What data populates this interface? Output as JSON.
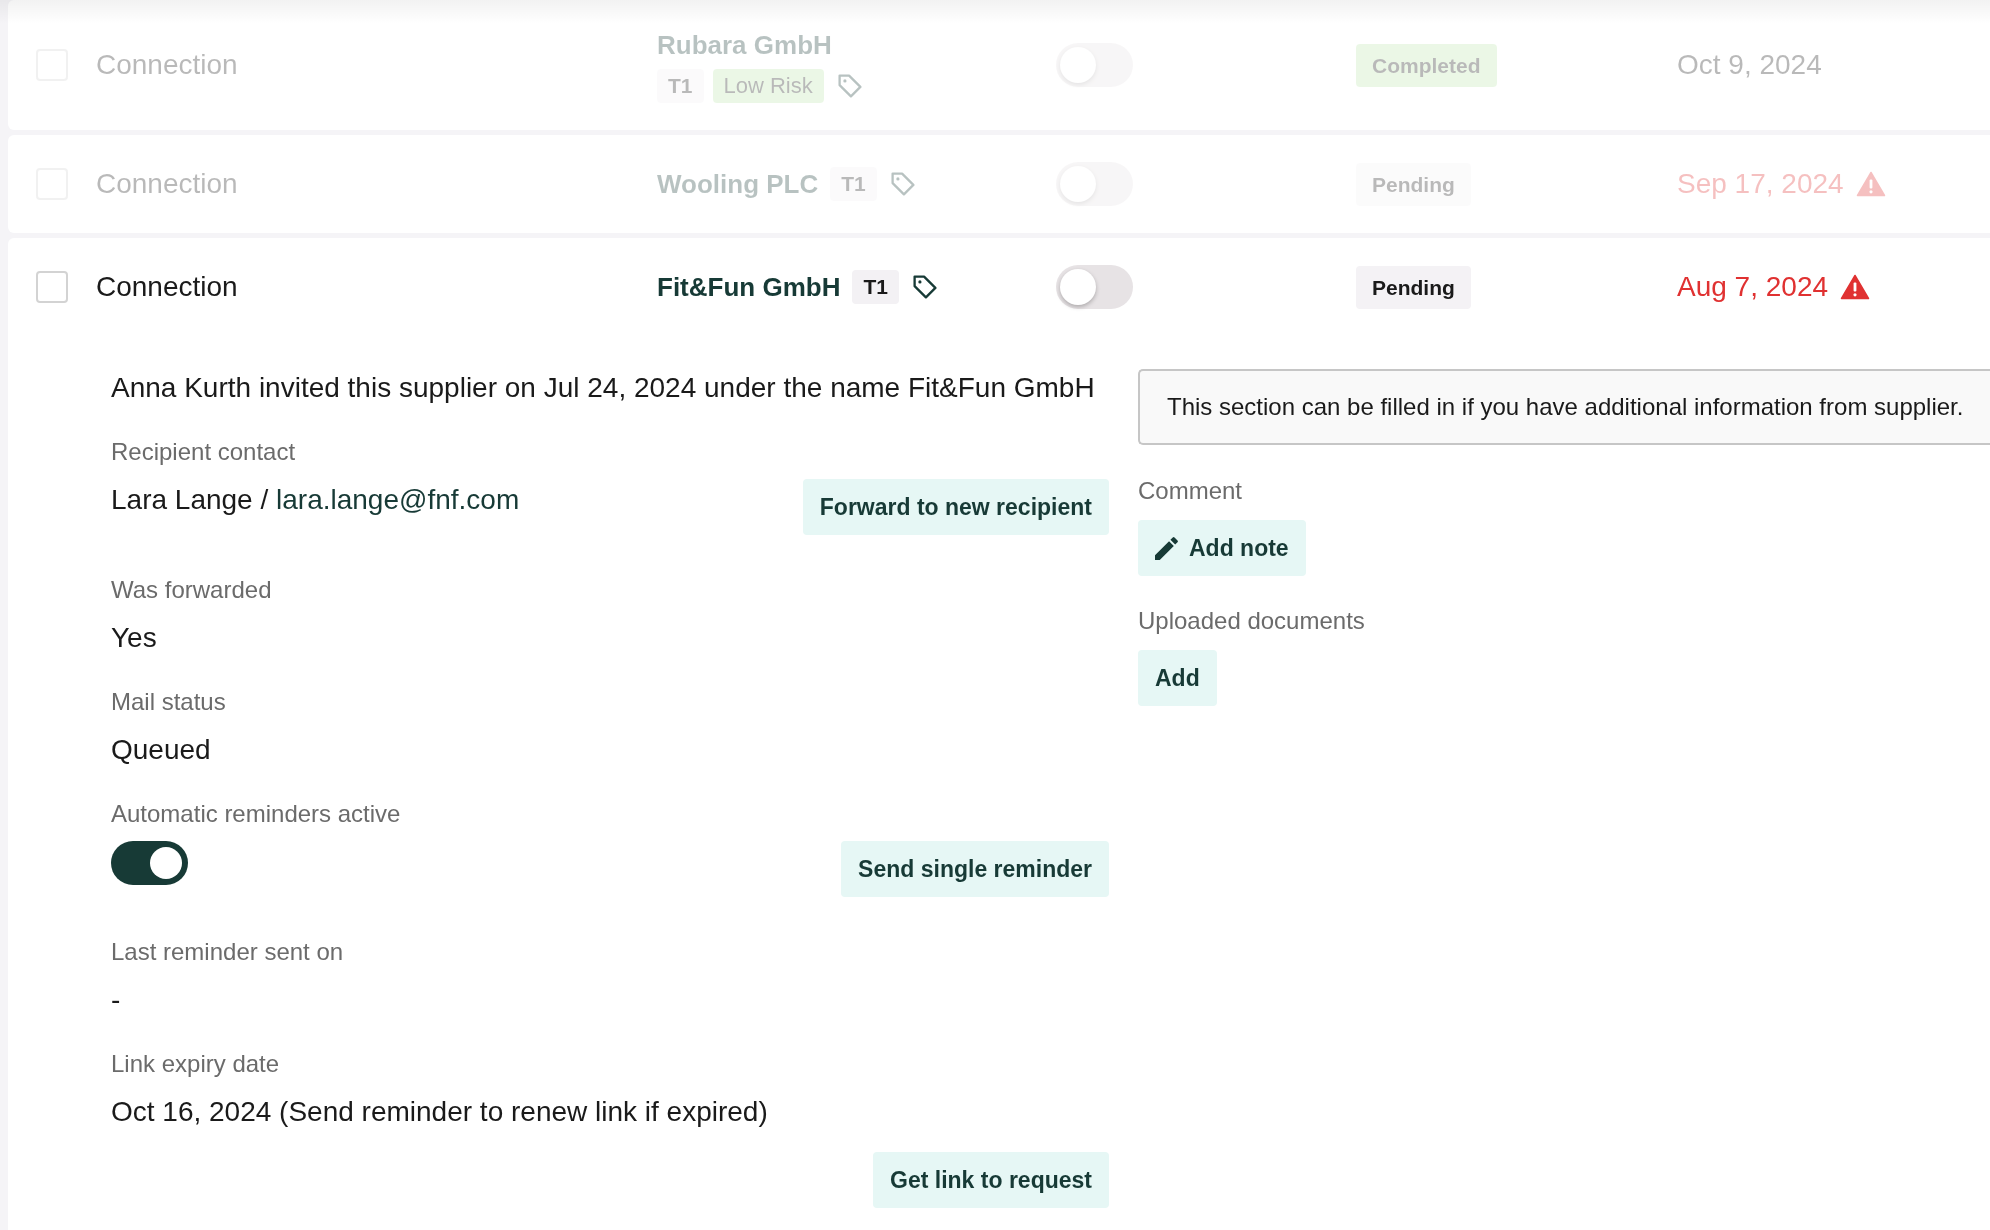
{
  "rows": [
    {
      "selected": false,
      "type_label": "Connection",
      "company": "Rubara GmbH",
      "tags": [
        {
          "label": "T1",
          "kind": "tier"
        },
        {
          "label": "Low Risk",
          "kind": "risk"
        }
      ],
      "switch_on": false,
      "status": {
        "label": "Completed",
        "kind": "completed"
      },
      "date": "Oct 9, 2024",
      "overdue": false,
      "expanded": false
    },
    {
      "selected": false,
      "type_label": "Connection",
      "company": "Wooling PLC",
      "tags": [
        {
          "label": "T1",
          "kind": "tier"
        }
      ],
      "switch_on": false,
      "status": {
        "label": "Pending",
        "kind": "pending"
      },
      "date": "Sep 17, 2024",
      "overdue": true,
      "expanded": false
    },
    {
      "selected": false,
      "type_label": "Connection",
      "company": "Fit&Fun GmbH",
      "tags": [
        {
          "label": "T1",
          "kind": "tier"
        }
      ],
      "switch_on": false,
      "status": {
        "label": "Pending",
        "kind": "pending"
      },
      "date": "Aug 7, 2024",
      "overdue": true,
      "expanded": true,
      "details": {
        "invite_note": "Anna Kurth invited this supplier on Jul 24, 2024 under the name Fit&Fun GmbH",
        "fields": [
          {
            "kind": "contact",
            "label": "Recipient contact",
            "prefix": "Lara Lange /",
            "email": "lara.lange@fnf.com",
            "button": "Forward to new recipient"
          },
          {
            "kind": "text",
            "label": "Was forwarded",
            "value": "Yes"
          },
          {
            "kind": "text",
            "label": "Mail status",
            "value": "Queued"
          },
          {
            "kind": "toggle",
            "label": "Automatic reminders active",
            "on": true,
            "button": "Send single reminder"
          },
          {
            "kind": "text",
            "label": "Last reminder sent on",
            "value": "-"
          },
          {
            "kind": "text",
            "label": "Link expiry date",
            "value": "Oct 16, 2024 (Send reminder to renew link if expired)"
          }
        ],
        "link_button": "Get link to request",
        "info_note": "This section can be filled in if you have additional information from supplier.",
        "comment": {
          "label": "Comment",
          "button": "Add note"
        },
        "documents": {
          "label": "Uploaded documents",
          "button": "Add"
        }
      }
    }
  ]
}
